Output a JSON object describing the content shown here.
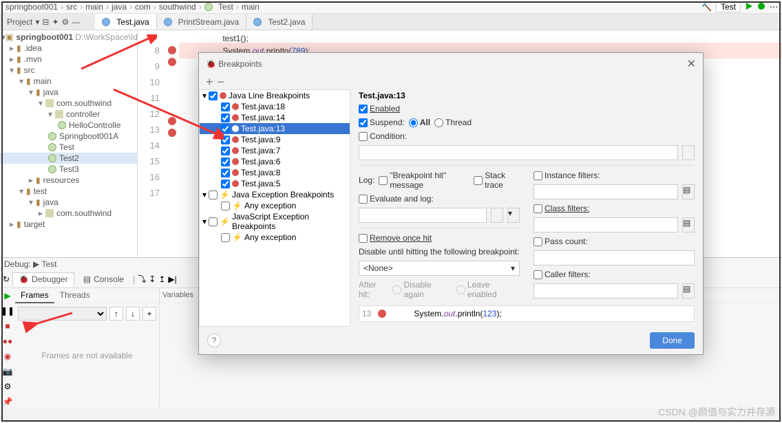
{
  "breadcrumb": [
    "springboot001",
    "src",
    "main",
    "java",
    "com",
    "southwind",
    "Test",
    "main"
  ],
  "run_config": "Test",
  "project_label": "Project",
  "project_root_name": "springboot001",
  "project_root_path": "D:\\WorkSpace\\Id",
  "tree": {
    "idea": ".idea",
    "mvn": ".mvn",
    "src": "src",
    "main": "main",
    "java": "java",
    "pkg": "com.southwind",
    "controller": "controller",
    "helloctrl": "HelloControlle",
    "springapp": "Springboot001A",
    "test": "Test",
    "test2": "Test2",
    "test3": "Test3",
    "resources": "resources",
    "testfolder": "test",
    "javaf": "java",
    "pkg2": "com.southwind",
    "target": "target"
  },
  "editor_tabs": [
    {
      "label": "Test.java",
      "icon": "java",
      "active": true
    },
    {
      "label": "PrintStream.java",
      "icon": "java",
      "active": false
    },
    {
      "label": "Test2.java",
      "icon": "java",
      "active": false
    }
  ],
  "gutter_lines": [
    "8",
    "9",
    "10",
    "11",
    "12",
    "13",
    "14",
    "15",
    "16",
    "17"
  ],
  "code_line_top": "    test1();",
  "code": {
    "pre": "    System.",
    "fld": "out",
    "mth": ".println(",
    "num": "789",
    "end": ");"
  },
  "debug_title": "Debug:",
  "debug_run": "Test",
  "debugger_tab": "Debugger",
  "console_tab": "Console",
  "frames_tab": "Frames",
  "threads_tab": "Threads",
  "variables_tab": "Variables",
  "frames_empty": "Frames are not available",
  "dialog": {
    "title": "Breakpoints",
    "sec_title": "Test.java:13",
    "tree": {
      "java_line": "Java Line Breakpoints",
      "items": [
        "Test.java:18",
        "Test.java:14",
        "Test.java:13",
        "Test.java:9",
        "Test.java:7",
        "Test.java:6",
        "Test.java:8",
        "Test.java:5"
      ],
      "selected_index": 2,
      "java_exc": "Java Exception Breakpoints",
      "any_exc": "Any exception",
      "js_exc": "JavaScript Exception Breakpoints",
      "any_exc2": "Any exception"
    },
    "labels": {
      "enabled": "Enabled",
      "suspend": "Suspend:",
      "all": "All",
      "thread": "Thread",
      "condition": "Condition:",
      "log": "Log:",
      "bp_hit": "\"Breakpoint hit\" message",
      "stack": "Stack trace",
      "eval": "Evaluate and log:",
      "remove": "Remove once hit",
      "disable_until": "Disable until hitting the following breakpoint:",
      "none": "<None>",
      "after_hit": "After hit:",
      "disable_again": "Disable again",
      "leave_enabled": "Leave enabled",
      "inst_filters": "Instance filters:",
      "class_filters": "Class filters:",
      "pass_count": "Pass count:",
      "caller_filters": "Caller filters:"
    },
    "preview": {
      "ln": "13",
      "pre": "System.",
      "fld": "out",
      "mth": ".println(",
      "num": "123",
      "end": ");"
    },
    "done": "Done"
  },
  "csdn": "CSDN @颜值与实力并存源"
}
